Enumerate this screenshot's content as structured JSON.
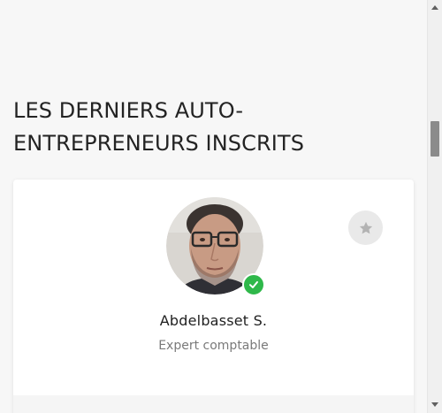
{
  "section": {
    "title": "LES DERNIERS AUTO-ENTREPRENEURS INSCRITS"
  },
  "card": {
    "name": "Abdelbasset S.",
    "profession": "Expert comptable",
    "verified": true,
    "favorite_icon": "star-icon",
    "verified_icon": "check-icon",
    "accent_color": "#2fb84a"
  }
}
